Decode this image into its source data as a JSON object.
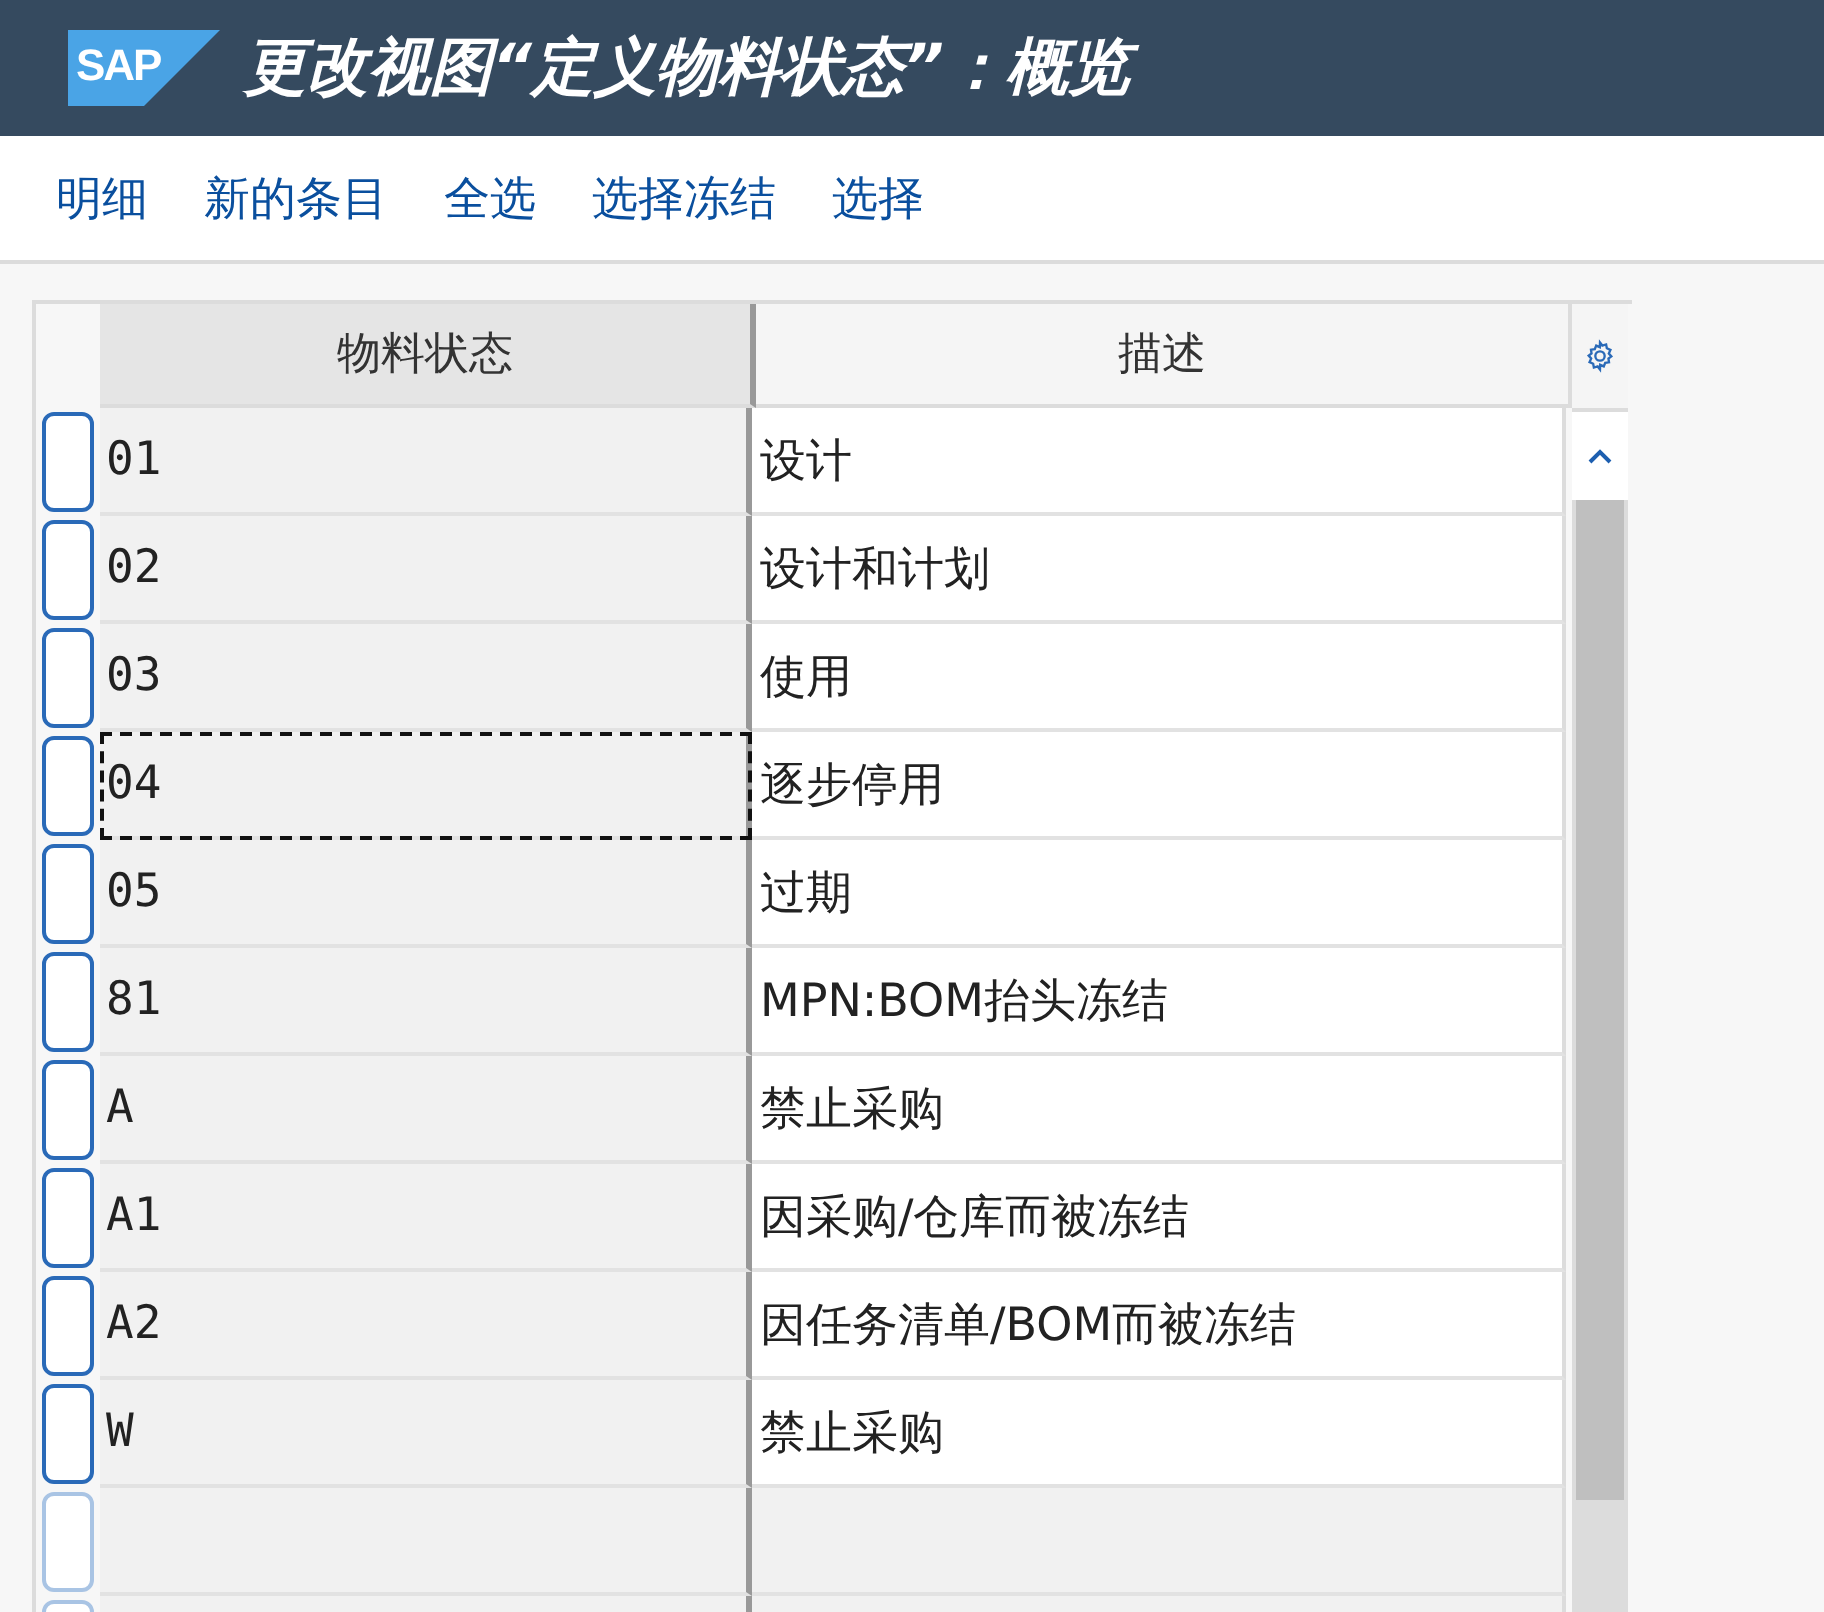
{
  "window": {
    "logo": "SAP",
    "title": "更改视图“定义物料状态”：概览"
  },
  "toolbar": [
    "明细",
    "新的条目",
    "全选",
    "选择冻结",
    "选择"
  ],
  "table": {
    "columns": [
      "物料状态",
      "描述"
    ],
    "rows": [
      {
        "kind": "entry",
        "code": "01",
        "description": "设计",
        "focused": false
      },
      {
        "kind": "entry",
        "code": "02",
        "description": "设计和计划",
        "focused": false
      },
      {
        "kind": "entry",
        "code": "03",
        "description": "使用",
        "focused": false
      },
      {
        "kind": "entry",
        "code": "04",
        "description": "逐步停用",
        "focused": true
      },
      {
        "kind": "entry",
        "code": "05",
        "description": "过期",
        "focused": false
      },
      {
        "kind": "entry",
        "code": "81",
        "description": "MPN:BOM抬头冻结",
        "focused": false
      },
      {
        "kind": "entry",
        "code": "A",
        "description": "禁止采购",
        "focused": false
      },
      {
        "kind": "entry",
        "code": "A1",
        "description": "因采购/仓库而被冻结",
        "focused": false
      },
      {
        "kind": "entry",
        "code": "A2",
        "description": "因任务清单/BOM而被冻结",
        "focused": false
      },
      {
        "kind": "entry",
        "code": "W",
        "description": "禁止采购",
        "focused": false
      },
      {
        "kind": "empty",
        "focused": false
      },
      {
        "kind": "empty",
        "focused": false
      }
    ]
  }
}
